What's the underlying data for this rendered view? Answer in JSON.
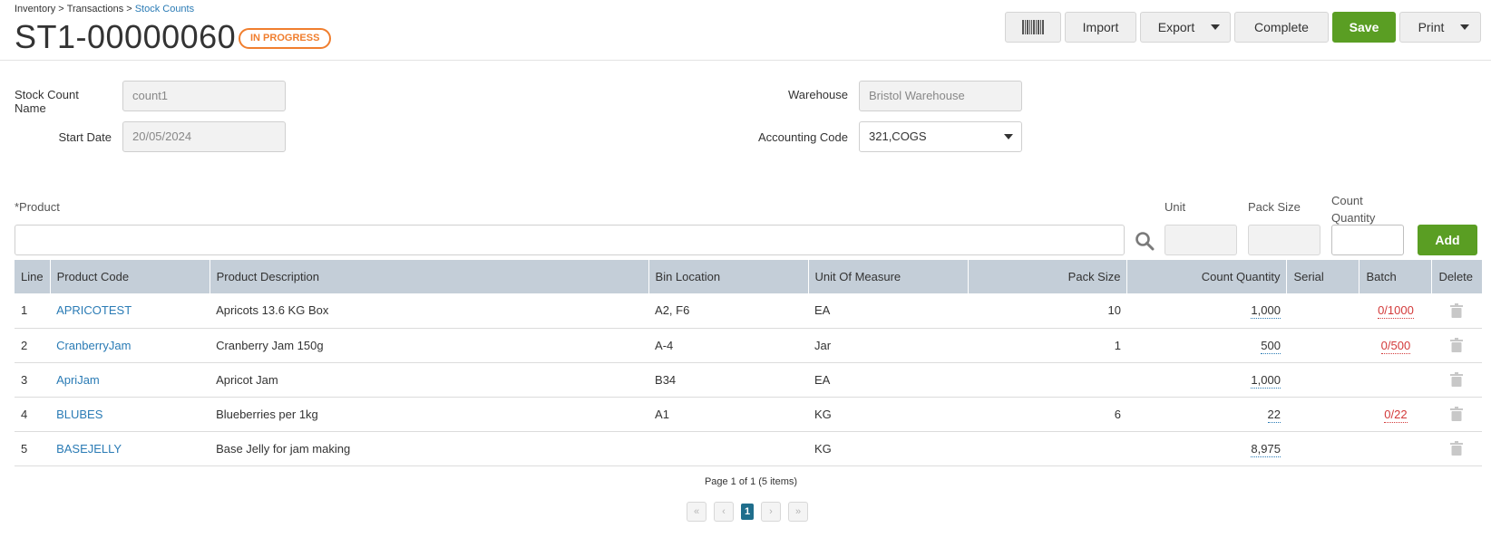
{
  "breadcrumb": {
    "items": [
      "Inventory",
      "Transactions"
    ],
    "current": "Stock Counts",
    "separator": ">"
  },
  "header": {
    "title": "ST1-00000060",
    "status": "IN PROGRESS"
  },
  "toolbar": {
    "barcode_icon": "barcode-icon",
    "import_label": "Import",
    "export_label": "Export",
    "complete_label": "Complete",
    "save_label": "Save",
    "print_label": "Print"
  },
  "form": {
    "stock_count_name": {
      "label": "Stock Count Name",
      "value": "count1"
    },
    "start_date": {
      "label": "Start Date",
      "value": "20/05/2024"
    },
    "warehouse": {
      "label": "Warehouse",
      "value": "Bristol Warehouse"
    },
    "accounting_code": {
      "label": "Accounting Code",
      "value": "321,COGS"
    }
  },
  "entry": {
    "product_label": "*Product",
    "unit_label": "Unit",
    "pack_size_label": "Pack Size",
    "count_quantity_label_1": "Count",
    "count_quantity_label_2": "Quantity",
    "add_label": "Add"
  },
  "table": {
    "columns": [
      "Line",
      "Product Code",
      "Product Description",
      "Bin Location",
      "Unit Of Measure",
      "Pack Size",
      "Count Quantity",
      "Serial",
      "Batch",
      "Delete"
    ],
    "rows": [
      {
        "line": "1",
        "code": "APRICOTEST",
        "description": "Apricots 13.6 KG Box",
        "bin": "A2, F6",
        "uom": "EA",
        "pack": "10",
        "qty": "1,000",
        "serial": "",
        "batch": "0/1000"
      },
      {
        "line": "2",
        "code": "CranberryJam",
        "description": "Cranberry Jam 150g",
        "bin": "A-4",
        "uom": "Jar",
        "pack": "1",
        "qty": "500",
        "serial": "",
        "batch": "0/500"
      },
      {
        "line": "3",
        "code": "ApriJam",
        "description": "Apricot Jam",
        "bin": "B34",
        "uom": "EA",
        "pack": "",
        "qty": "1,000",
        "serial": "",
        "batch": ""
      },
      {
        "line": "4",
        "code": "BLUBES",
        "description": "Blueberries per 1kg",
        "bin": "A1",
        "uom": "KG",
        "pack": "6",
        "qty": "22",
        "serial": "",
        "batch": "0/22"
      },
      {
        "line": "5",
        "code": "BASEJELLY",
        "description": "Base Jelly for jam making",
        "bin": "",
        "uom": "KG",
        "pack": "",
        "qty": "8,975",
        "serial": "",
        "batch": ""
      }
    ]
  },
  "pager": {
    "info": "Page 1 of 1 (5 items)",
    "current": "1",
    "first": "«",
    "prev": "‹",
    "next": "›",
    "last": "»"
  },
  "colors": {
    "accent_green": "#5a9e23",
    "status_orange": "#f07e2e",
    "link_blue": "#2a7bb5",
    "header_gray": "#c4ced8",
    "batch_red": "#d33a3a"
  }
}
